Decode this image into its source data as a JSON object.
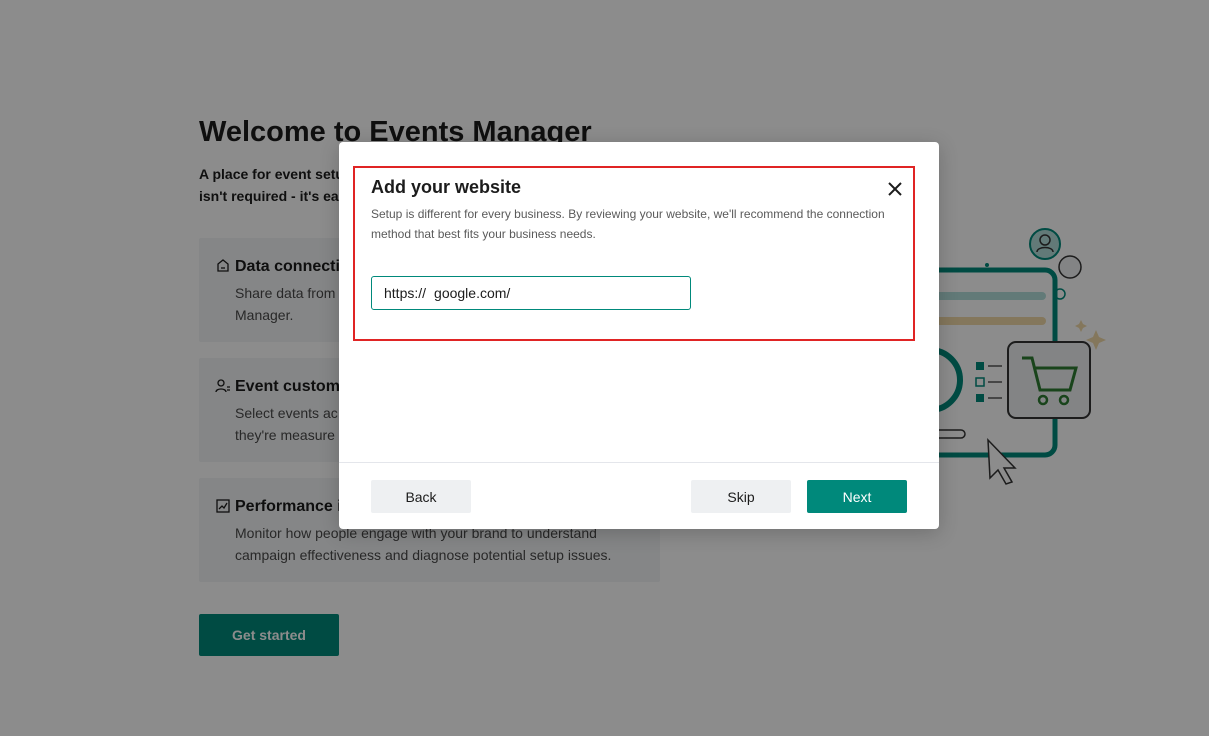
{
  "background": {
    "title": "Welcome to Events Manager",
    "subtitle_line1": "A place for event setu",
    "subtitle_line2": "isn't required - it's ea",
    "cards": [
      {
        "title": "Data connecti",
        "desc_line1": "Share data from",
        "desc_line2": "Manager.",
        "icon": "data-connection-icon"
      },
      {
        "title": "Event customi",
        "desc_line1": "Select events ac",
        "desc_line2": "they're measure",
        "icon": "user-settings-icon"
      },
      {
        "title": "Performance i",
        "desc_line1": "Monitor how people engage with your brand to understand",
        "desc_line2": "campaign effectiveness and diagnose potential setup issues.",
        "icon": "chart-icon"
      }
    ],
    "get_started_label": "Get started"
  },
  "modal": {
    "title": "Add your website",
    "description": "Setup is different for every business. By reviewing your website, we'll recommend the connection method that best fits your business needs.",
    "url_prefix": "https://",
    "url_value": "google.com/",
    "back_label": "Back",
    "skip_label": "Skip",
    "next_label": "Next"
  },
  "colors": {
    "accent": "#00897b",
    "highlight": "#e02424"
  }
}
